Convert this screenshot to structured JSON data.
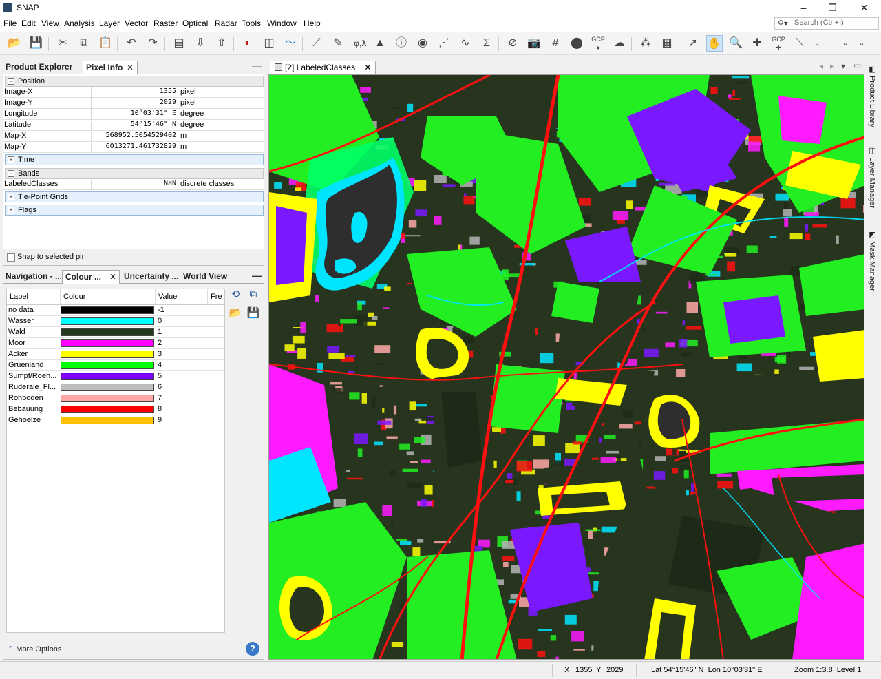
{
  "app": {
    "title": "SNAP"
  },
  "window_controls": {
    "minimize": "–",
    "restore": "❐",
    "close": "✕"
  },
  "menu": [
    "File",
    "Edit",
    "View",
    "Analysis",
    "Layer",
    "Vector",
    "Raster",
    "Optical",
    "Radar",
    "Tools",
    "Window",
    "Help"
  ],
  "search": {
    "placeholder": "Search (Ctrl+I)"
  },
  "toolbar": {
    "gcp_label": "GCP",
    "gcp_label2": "GCP",
    "phi_lambda": "φ,λ",
    "sigma": "Σ"
  },
  "left_top": {
    "tabs": [
      "Product Explorer",
      "Pixel Info"
    ],
    "close": "✕",
    "minimize": "—",
    "sections": {
      "position": "Position",
      "time": "Time",
      "bands": "Bands",
      "tiepoints": "Tie-Point Grids",
      "flags": "Flags"
    },
    "position_rows": [
      {
        "k": "Image-X",
        "v": "1355",
        "u": "pixel"
      },
      {
        "k": "Image-Y",
        "v": "2029",
        "u": "pixel"
      },
      {
        "k": "Longitude",
        "v": "10°03'31\" E",
        "u": "degree"
      },
      {
        "k": "Latitude",
        "v": "54°15'46\" N",
        "u": "degree"
      },
      {
        "k": "Map-X",
        "v": "568952.5054529402",
        "u": "m"
      },
      {
        "k": "Map-Y",
        "v": "6013271.461732829",
        "u": "m"
      }
    ],
    "band_rows": [
      {
        "k": "LabeledClasses",
        "v": "NaN",
        "u": "discrete classes"
      }
    ],
    "snap_label": "Snap to selected pin"
  },
  "left_bottom": {
    "tabs": [
      "Navigation - ...",
      "Colour ...",
      "Uncertainty ...",
      "World View"
    ],
    "close": "✕",
    "minimize": "—",
    "columns": [
      "Label",
      "Colour",
      "Value",
      "Fre"
    ],
    "rows": [
      {
        "label": "no data",
        "color": "#000000",
        "value": "-1"
      },
      {
        "label": "Wasser",
        "color": "#00FFFF",
        "value": "0"
      },
      {
        "label": "Wald",
        "color": "#243A1F",
        "value": "1"
      },
      {
        "label": "Moor",
        "color": "#FF00FF",
        "value": "2"
      },
      {
        "label": "Acker",
        "color": "#FFFF00",
        "value": "3"
      },
      {
        "label": "Gruenland",
        "color": "#00FF00",
        "value": "4"
      },
      {
        "label": "Sumpf/Roeh...",
        "color": "#7B00FF",
        "value": "5"
      },
      {
        "label": "Ruderale_Fl...",
        "color": "#BEBEBE",
        "value": "6"
      },
      {
        "label": "Rohboden",
        "color": "#FFA8A8",
        "value": "7"
      },
      {
        "label": "Bebauung",
        "color": "#FF0000",
        "value": "8"
      },
      {
        "label": "Gehoelze",
        "color": "#FFC000",
        "value": "9"
      }
    ],
    "more_options": "More Options",
    "help": "?"
  },
  "image_view": {
    "tab": "[2] LabeledClasses",
    "close": "✕"
  },
  "right_sidebar": [
    "Product Library",
    "Layer Manager",
    "Mask Manager"
  ],
  "status": {
    "x_label": "X",
    "x": "1355",
    "y_label": "Y",
    "y": "2029",
    "latlon": "Lat 54°15'46\" N  Lon 10°03'31\" E",
    "zoom": "Zoom 1:3.8  Level 1"
  }
}
